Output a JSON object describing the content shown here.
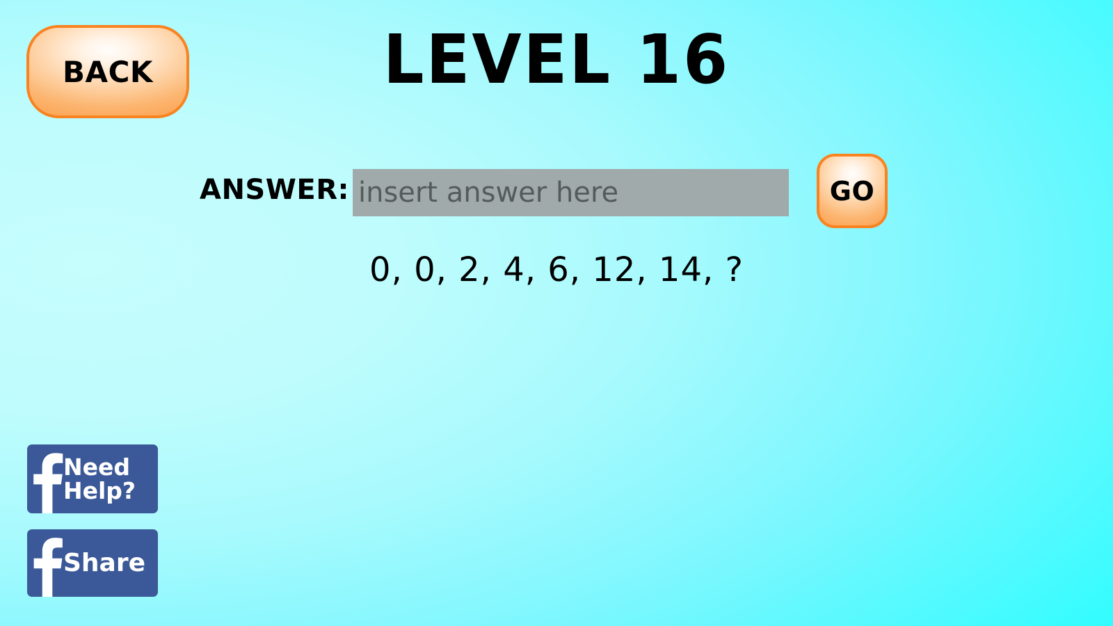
{
  "app": {
    "background_start_color": "#c6fdfd",
    "background_end_color": "#00ffff"
  },
  "header": {
    "title": "LEVEL 16",
    "back_label": "BACK"
  },
  "answer": {
    "label": "ANSWER:",
    "placeholder": "insert answer here",
    "value": "",
    "submit_label": "GO"
  },
  "puzzle": {
    "sequence": "0, 0, 2, 4, 6, 12, 14, ?",
    "terms": [
      0,
      0,
      2,
      4,
      6,
      12,
      14
    ],
    "unknown": "?"
  },
  "social": {
    "brand_color": "#3b5998",
    "need_help_label": "Need\nHelp?",
    "share_label": "Share",
    "facebook_icon": "facebook-f-icon"
  },
  "theme": {
    "button_border_color": "#f98320",
    "button_fill_highlight": "#fffdfb",
    "button_fill_shade": "#faa552",
    "input_background": "#a0aaaa",
    "placeholder_color": "#555b5b"
  }
}
